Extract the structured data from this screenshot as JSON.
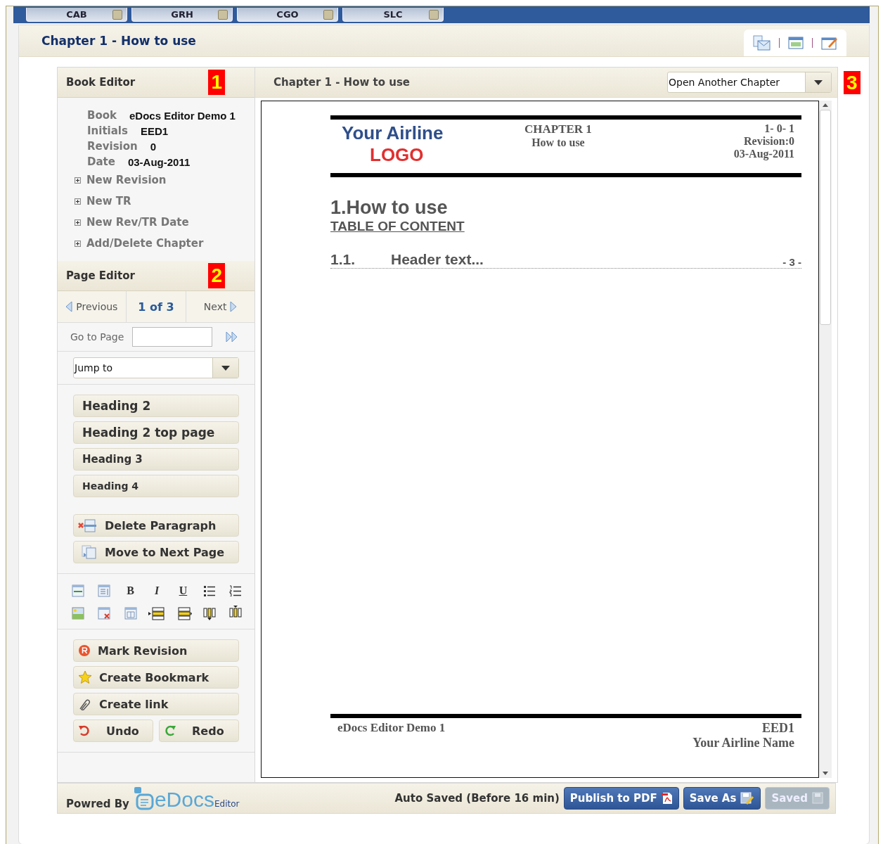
{
  "top_tabs": [
    {
      "label": "CAB"
    },
    {
      "label": "GRH"
    },
    {
      "label": "CGO"
    },
    {
      "label": "SLC"
    }
  ],
  "page_header": {
    "title": "Chapter 1 - How to use"
  },
  "book_editor": {
    "title": "Book Editor",
    "marker": "1",
    "info": [
      {
        "label": "Book",
        "value": "eDocs Editor Demo 1"
      },
      {
        "label": "Initials",
        "value": "EED1"
      },
      {
        "label": "Revision",
        "value": "0"
      },
      {
        "label": "Date",
        "value": "03-Aug-2011"
      }
    ],
    "actions": [
      "New Revision",
      "New TR",
      "New Rev/TR Date",
      "Add/Delete Chapter"
    ]
  },
  "page_editor": {
    "title": "Page Editor",
    "marker": "2",
    "previous": "Previous",
    "page": "1 of 3",
    "next": "Next",
    "goto_label": "Go to Page",
    "jump_to": "Jump to",
    "style_buttons": [
      "Heading 2",
      "Heading 2 top page",
      "Heading 3",
      "Heading 4"
    ],
    "paragraph_buttons": [
      {
        "kind": "delete",
        "label": "Delete Paragraph"
      },
      {
        "kind": "move",
        "label": "Move to Next Page"
      }
    ],
    "toolbar": [
      {
        "kind": "table-insert"
      },
      {
        "kind": "table-props"
      },
      {
        "kind": "bold",
        "label": "B"
      },
      {
        "kind": "italic",
        "label": "I"
      },
      {
        "kind": "underline",
        "label": "U"
      },
      {
        "kind": "bullets"
      },
      {
        "kind": "numbers"
      },
      {
        "kind": "image"
      },
      {
        "kind": "table-delete"
      },
      {
        "kind": "table"
      },
      {
        "kind": "row-before"
      },
      {
        "kind": "row-after"
      },
      {
        "kind": "col-before"
      },
      {
        "kind": "col-after"
      }
    ],
    "actions": [
      {
        "kind": "revision",
        "label": "Mark Revision"
      },
      {
        "kind": "bookmark",
        "label": "Create Bookmark"
      },
      {
        "kind": "link",
        "label": "Create link"
      }
    ],
    "undo": "Undo",
    "redo": "Redo"
  },
  "document": {
    "title": "Chapter 1 - How to use",
    "chapter_select": "Open Another Chapter",
    "marker": "3",
    "header": {
      "logo_line1": "Your Airline",
      "logo_line2": "LOGO",
      "chapter": "CHAPTER 1",
      "subtitle": "How to use",
      "code": "1- 0- 1",
      "revision": "Revision:0",
      "date": "03-Aug-2011"
    },
    "heading": "1.How to use",
    "toc_title": "TABLE OF CONTENT",
    "toc": [
      {
        "number": "1.1.",
        "text": "Header text...",
        "page": "- 3 -"
      }
    ],
    "footer": {
      "left": "eDocs Editor Demo 1",
      "right_1": "EED1",
      "right_2": "Your Airline Name"
    }
  },
  "footer": {
    "powered_by": "Powred By",
    "logo": "eDocs",
    "logo_sub": "Editor",
    "status": "Auto Saved (Before 16 min)",
    "buttons": [
      {
        "kind": "publish",
        "label": "Publish to PDF",
        "disabled": false
      },
      {
        "kind": "save-as",
        "label": "Save As",
        "disabled": false
      },
      {
        "kind": "saved",
        "label": "Saved",
        "disabled": true
      }
    ]
  }
}
